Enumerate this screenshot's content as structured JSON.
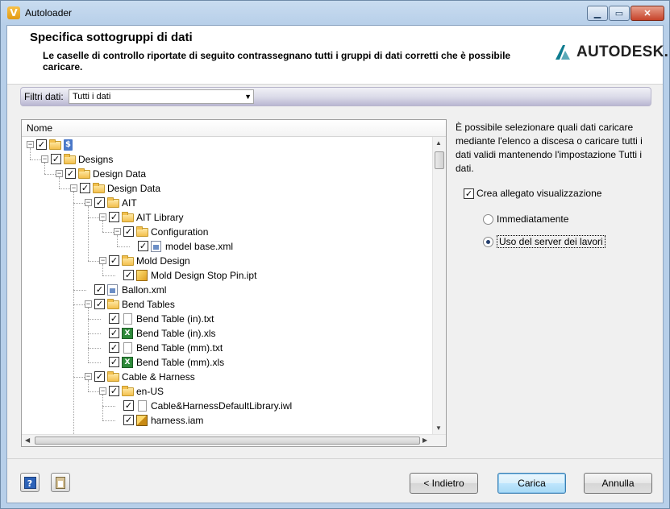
{
  "window": {
    "title": "Autoloader",
    "app_icon_letter": "V"
  },
  "header": {
    "title": "Specifica sottogruppi di dati",
    "description": "Le caselle di controllo riportate di seguito contrassegnano tutti i gruppi di dati corretti che è possibile caricare.",
    "logo_text": "AUTODESK."
  },
  "filter": {
    "label": "Filtri dati:",
    "value": "Tutti i dati"
  },
  "tree": {
    "column_header": "Nome",
    "items": [
      {
        "label": "$",
        "level": 0,
        "icon": "root",
        "checked": true,
        "expanded": true
      },
      {
        "label": "Designs",
        "level": 1,
        "icon": "folder",
        "checked": true,
        "expanded": true
      },
      {
        "label": "Design Data",
        "level": 2,
        "icon": "folder",
        "checked": true,
        "expanded": true
      },
      {
        "label": "Design Data",
        "level": 3,
        "icon": "folder",
        "checked": true,
        "expanded": true
      },
      {
        "label": "AIT",
        "level": 4,
        "icon": "folder",
        "checked": true,
        "expanded": true
      },
      {
        "label": "AIT Library",
        "level": 5,
        "icon": "folder",
        "checked": true,
        "expanded": true
      },
      {
        "label": "Configuration",
        "level": 6,
        "icon": "folder",
        "checked": true,
        "expanded": true
      },
      {
        "label": "model base.xml",
        "level": 7,
        "icon": "xml",
        "checked": true,
        "expanded": null
      },
      {
        "label": "Mold Design",
        "level": 5,
        "icon": "folder",
        "checked": true,
        "expanded": true
      },
      {
        "label": "Mold Design Stop Pin.ipt",
        "level": 6,
        "icon": "ipt",
        "checked": true,
        "expanded": null
      },
      {
        "label": "Ballon.xml",
        "level": 4,
        "icon": "xml",
        "checked": true,
        "expanded": null
      },
      {
        "label": "Bend Tables",
        "level": 4,
        "icon": "folder",
        "checked": true,
        "expanded": true
      },
      {
        "label": "Bend Table (in).txt",
        "level": 5,
        "icon": "file",
        "checked": true,
        "expanded": null
      },
      {
        "label": "Bend Table (in).xls",
        "level": 5,
        "icon": "xls",
        "checked": true,
        "expanded": null
      },
      {
        "label": "Bend Table (mm).txt",
        "level": 5,
        "icon": "file",
        "checked": true,
        "expanded": null
      },
      {
        "label": "Bend Table (mm).xls",
        "level": 5,
        "icon": "xls",
        "checked": true,
        "expanded": null
      },
      {
        "label": "Cable & Harness",
        "level": 4,
        "icon": "folder",
        "checked": true,
        "expanded": true
      },
      {
        "label": "en-US",
        "level": 5,
        "icon": "folder",
        "checked": true,
        "expanded": true
      },
      {
        "label": "Cable&HarnessDefaultLibrary.iwl",
        "level": 6,
        "icon": "file",
        "checked": true,
        "expanded": null
      },
      {
        "label": "harness.iam",
        "level": 6,
        "icon": "iam",
        "checked": true,
        "expanded": null
      }
    ]
  },
  "info_text": "È possibile selezionare quali dati caricare mediante l'elenco a discesa o caricare tutti i dati validi mantenendo l'impostazione Tutti i dati.",
  "options": {
    "create_attachment_label": "Crea allegato visualizzazione",
    "create_attachment_checked": true,
    "radio_immediately": "Immediatamente",
    "radio_job_server": "Uso del server dei lavori",
    "selected": "job_server"
  },
  "buttons": {
    "back": "< Indietro",
    "load": "Carica",
    "cancel": "Annulla"
  },
  "colors": {
    "accent": "#3c7fb1",
    "title_bar": "#b7cfe9",
    "filter_bar": "#b9b6d2"
  }
}
